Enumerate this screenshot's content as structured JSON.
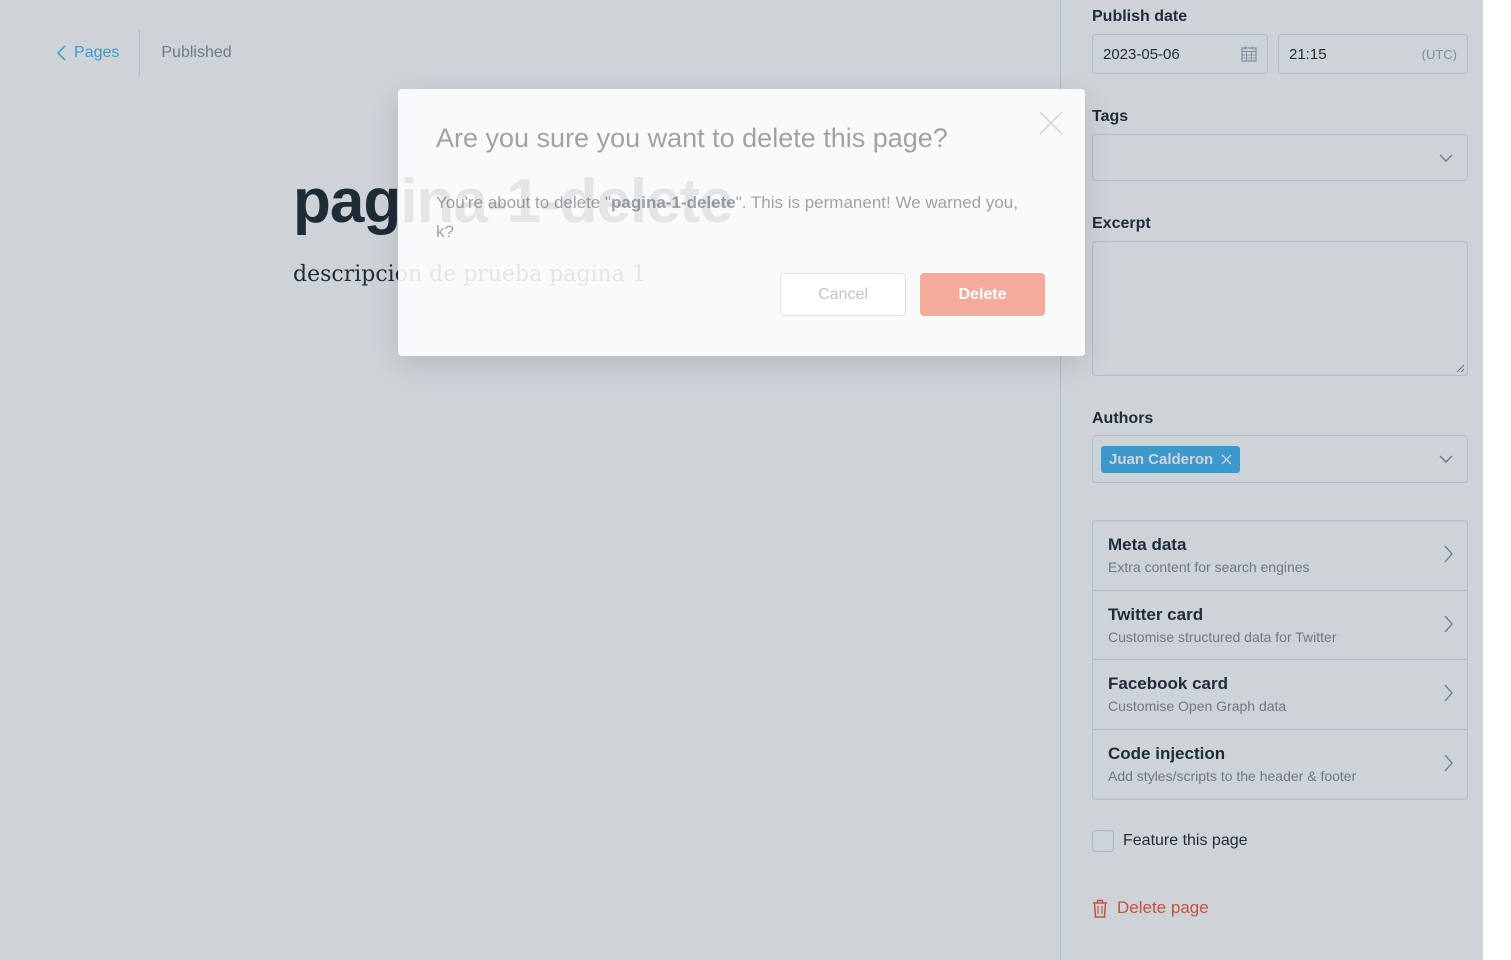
{
  "header": {
    "back_label": "Pages",
    "status": "Published"
  },
  "post": {
    "title": "pagina-1-delete",
    "body": "descripcion de prueba pagina 1"
  },
  "settings": {
    "publish_date_label": "Publish date",
    "date_value": "2023-05-06",
    "time_value": "21:15",
    "timezone": "(UTC)",
    "tags_label": "Tags",
    "excerpt_label": "Excerpt",
    "authors_label": "Authors",
    "author_chip": "Juan Calderon",
    "accordion": [
      {
        "title": "Meta data",
        "subtitle": "Extra content for search engines"
      },
      {
        "title": "Twitter card",
        "subtitle": "Customise structured data for Twitter"
      },
      {
        "title": "Facebook card",
        "subtitle": "Customise Open Graph data"
      },
      {
        "title": "Code injection",
        "subtitle": "Add styles/scripts to the header & footer"
      }
    ],
    "feature_label": "Feature this page",
    "delete_label": "Delete page"
  },
  "modal": {
    "title": "Are you sure you want to delete this page?",
    "body_prefix": "You're about to delete \"",
    "body_name": "pagina-1-delete",
    "body_suffix": "\". This is permanent! We warned you, k?",
    "cancel_label": "Cancel",
    "delete_label": "Delete"
  },
  "colors": {
    "accent": "#3eb0ef",
    "danger": "#f05230",
    "danger_disabled": "#f4ab9c"
  },
  "icons": {
    "back": "chevron-left-icon",
    "calendar": "calendar-icon",
    "dropdown": "chevron-down-icon",
    "remove_author": "close-icon",
    "accordion": "chevron-right-icon",
    "trash": "trash-icon",
    "modal_close": "close-icon"
  }
}
